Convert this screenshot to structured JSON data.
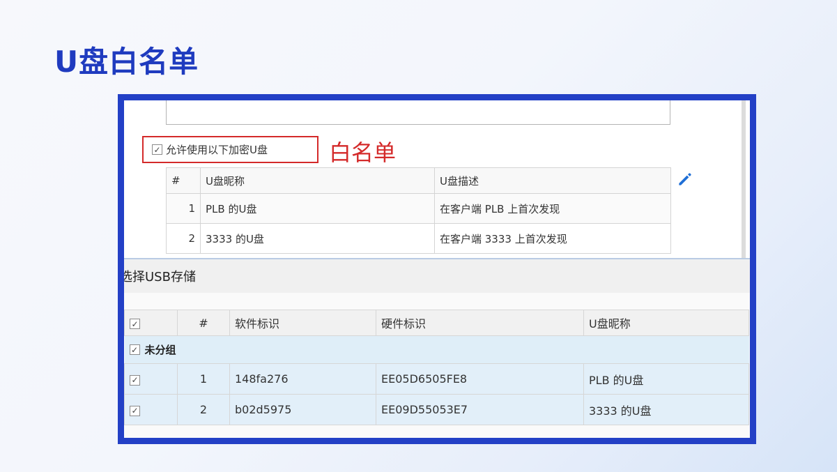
{
  "slide": {
    "title": "U盘白名单"
  },
  "whitelist": {
    "allow_label": "允许使用以下加密U盘",
    "allow_checked": true,
    "annotation": "白名单",
    "edit_icon": "pencil-icon",
    "columns": {
      "index": "#",
      "name": "U盘昵称",
      "desc": "U盘描述"
    },
    "rows": [
      {
        "index": "1",
        "name": "PLB 的U盘",
        "desc": "在客户端 PLB 上首次发现"
      },
      {
        "index": "2",
        "name": "3333 的U盘",
        "desc": "在客户端 3333 上首次发现"
      }
    ]
  },
  "usb_dialog": {
    "title": "选择USB存储",
    "columns": {
      "check": "☑",
      "index": "#",
      "software_id": "软件标识",
      "hardware_id": "硬件标识",
      "nickname": "U盘昵称"
    },
    "group": {
      "label": "未分组",
      "checked": true
    },
    "rows": [
      {
        "checked": true,
        "index": "1",
        "software_id": "148fa276",
        "hardware_id": "EE05D6505FE8",
        "nickname": "PLB 的U盘"
      },
      {
        "checked": true,
        "index": "2",
        "software_id": "b02d5975",
        "hardware_id": "EE09D55053E7",
        "nickname": "3333 的U盘"
      }
    ]
  },
  "colors": {
    "frame": "#2340c6",
    "title": "#1f3bbf",
    "annotation": "#d42a2a",
    "row_highlight": "#e2eff9"
  }
}
